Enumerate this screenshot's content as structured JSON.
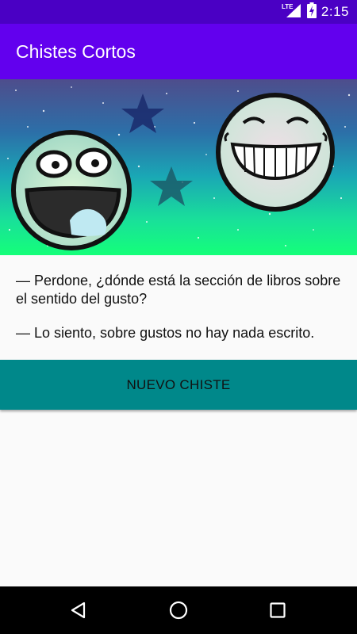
{
  "status_bar": {
    "network": "LTE",
    "time": "2:15",
    "icons": [
      "lte-signal-icon",
      "battery-charging-icon"
    ]
  },
  "app_bar": {
    "title": "Chistes Cortos",
    "color": "#6200ee"
  },
  "banner": {
    "description_icons": [
      "laughing-face-icon",
      "grinning-face-icon",
      "star-icon"
    ]
  },
  "joke": {
    "line1": "— Perdone, ¿dónde está la sección de libros sobre el sentido del gusto?",
    "line2": "— Lo siento, sobre gustos no hay nada escrito."
  },
  "button": {
    "label": "NUEVO CHISTE",
    "color": "#00888a"
  },
  "nav_bar": {
    "icons": [
      "back-icon",
      "home-icon",
      "recents-icon"
    ]
  }
}
